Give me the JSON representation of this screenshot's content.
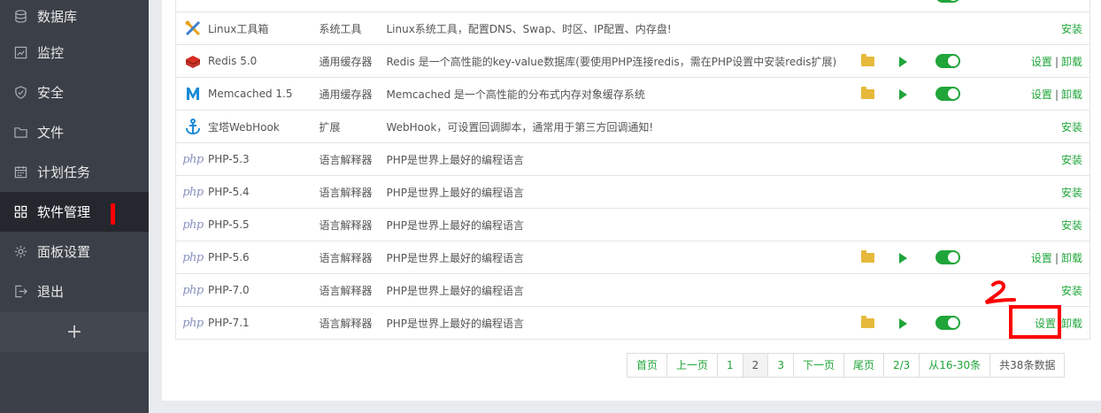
{
  "sidebar": {
    "items": [
      {
        "label": "数据库",
        "icon": "database-icon"
      },
      {
        "label": "监控",
        "icon": "monitor-icon"
      },
      {
        "label": "安全",
        "icon": "shield-icon"
      },
      {
        "label": "文件",
        "icon": "folder-icon"
      },
      {
        "label": "计划任务",
        "icon": "calendar-icon"
      },
      {
        "label": "软件管理",
        "icon": "grid-icon",
        "active": true
      },
      {
        "label": "面板设置",
        "icon": "gear-icon"
      },
      {
        "label": "退出",
        "icon": "logout-icon"
      }
    ],
    "add_label": "+"
  },
  "software": [
    {
      "name": "Linux工具箱",
      "type": "系统工具",
      "desc": "Linux系统工具，配置DNS、Swap、时区、IP配置、内存盘!",
      "icon": "tools-icon",
      "installed": false,
      "op_install": "安装"
    },
    {
      "name": "Redis 5.0",
      "type": "通用缓存器",
      "desc": "Redis 是一个高性能的key-value数据库(要使用PHP连接redis，需在PHP设置中安装redis扩展)",
      "icon": "redis-icon",
      "installed": true,
      "op_settings": "设置",
      "op_sep": "|",
      "op_uninstall": "卸载"
    },
    {
      "name": "Memcached 1.5",
      "type": "通用缓存器",
      "desc": "Memcached 是一个高性能的分布式内存对象缓存系统",
      "icon": "memcached-icon",
      "installed": true,
      "op_settings": "设置",
      "op_sep": "|",
      "op_uninstall": "卸载"
    },
    {
      "name": "宝塔WebHook",
      "type": "扩展",
      "desc": "WebHook，可设置回调脚本，通常用于第三方回调通知!",
      "icon": "anchor-icon",
      "installed": false,
      "op_install": "安装"
    },
    {
      "name": "PHP-5.3",
      "type": "语言解释器",
      "desc": "PHP是世界上最好的编程语言",
      "icon": "php-icon",
      "installed": false,
      "op_install": "安装"
    },
    {
      "name": "PHP-5.4",
      "type": "语言解释器",
      "desc": "PHP是世界上最好的编程语言",
      "icon": "php-icon",
      "installed": false,
      "op_install": "安装"
    },
    {
      "name": "PHP-5.5",
      "type": "语言解释器",
      "desc": "PHP是世界上最好的编程语言",
      "icon": "php-icon",
      "installed": false,
      "op_install": "安装"
    },
    {
      "name": "PHP-5.6",
      "type": "语言解释器",
      "desc": "PHP是世界上最好的编程语言",
      "icon": "php-icon",
      "installed": true,
      "op_settings": "设置",
      "op_sep": "|",
      "op_uninstall": "卸载"
    },
    {
      "name": "PHP-7.0",
      "type": "语言解释器",
      "desc": "PHP是世界上最好的编程语言",
      "icon": "php-icon",
      "installed": false,
      "op_install": "安装"
    },
    {
      "name": "PHP-7.1",
      "type": "语言解释器",
      "desc": "PHP是世界上最好的编程语言",
      "icon": "php-icon",
      "installed": true,
      "op_settings": "设置",
      "op_sep": "",
      "op_uninstall": "卸载"
    }
  ],
  "php_logo_text": "php",
  "pagination": {
    "first": "首页",
    "prev": "上一页",
    "pages": [
      "1",
      "2",
      "3"
    ],
    "current": "2",
    "next": "下一页",
    "last": "尾页",
    "page_info": "2/3",
    "range": "从16-30条",
    "total": "共38条数据"
  },
  "annotation_number": "2",
  "colors": {
    "accent": "#20a53a",
    "sidebar_bg": "#3b4048",
    "sidebar_active": "#24272d",
    "annotation": "#ff0000"
  }
}
